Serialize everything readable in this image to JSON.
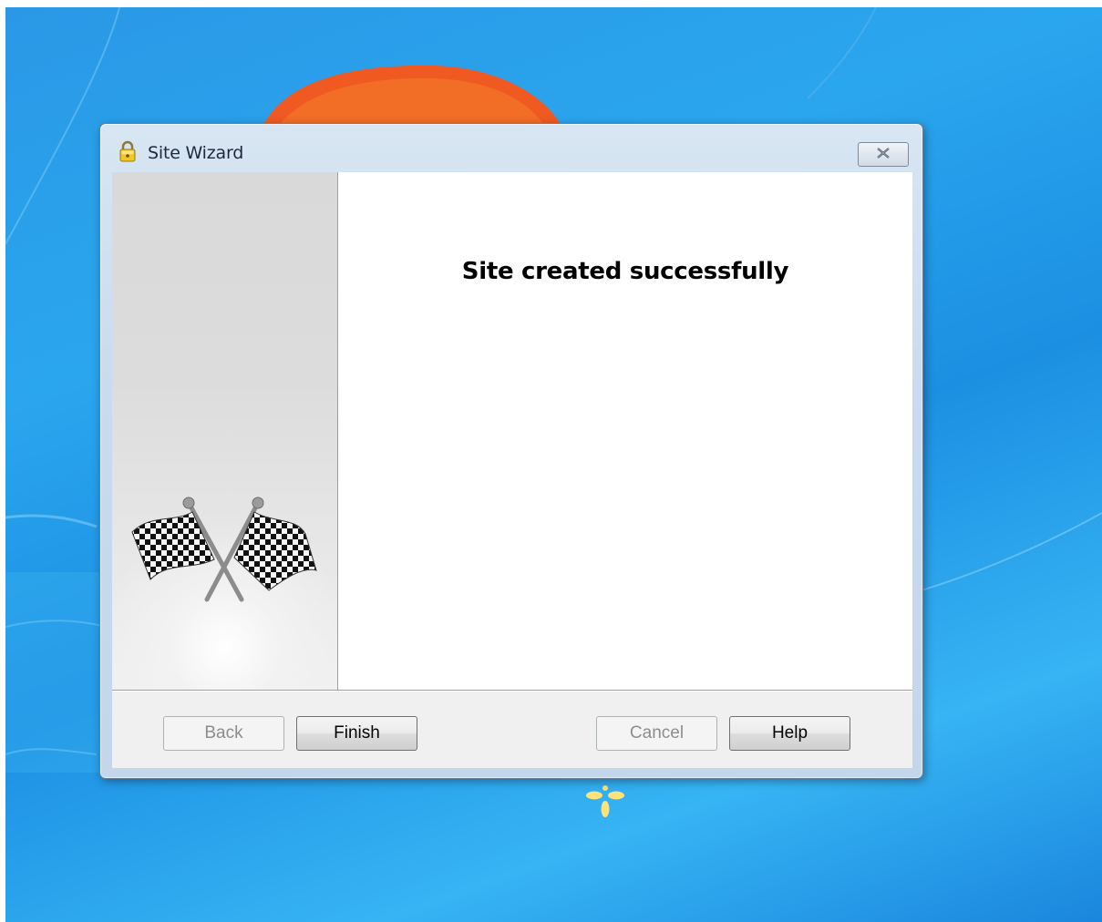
{
  "window": {
    "title": "Site Wizard",
    "title_icon": "padlock-icon",
    "close_icon": "close-icon"
  },
  "side_panel": {
    "image": "checkered-flags-icon"
  },
  "content": {
    "heading": "Site created successfully"
  },
  "buttons": {
    "back": {
      "label": "Back",
      "enabled": false
    },
    "finish": {
      "label": "Finish",
      "enabled": true
    },
    "cancel": {
      "label": "Cancel",
      "enabled": false
    },
    "help": {
      "label": "Help",
      "enabled": true
    }
  },
  "colors": {
    "desktop_blue": "#2a98e6",
    "title_bar": "#c9dbee",
    "dialog_face": "#f0f0f0"
  }
}
